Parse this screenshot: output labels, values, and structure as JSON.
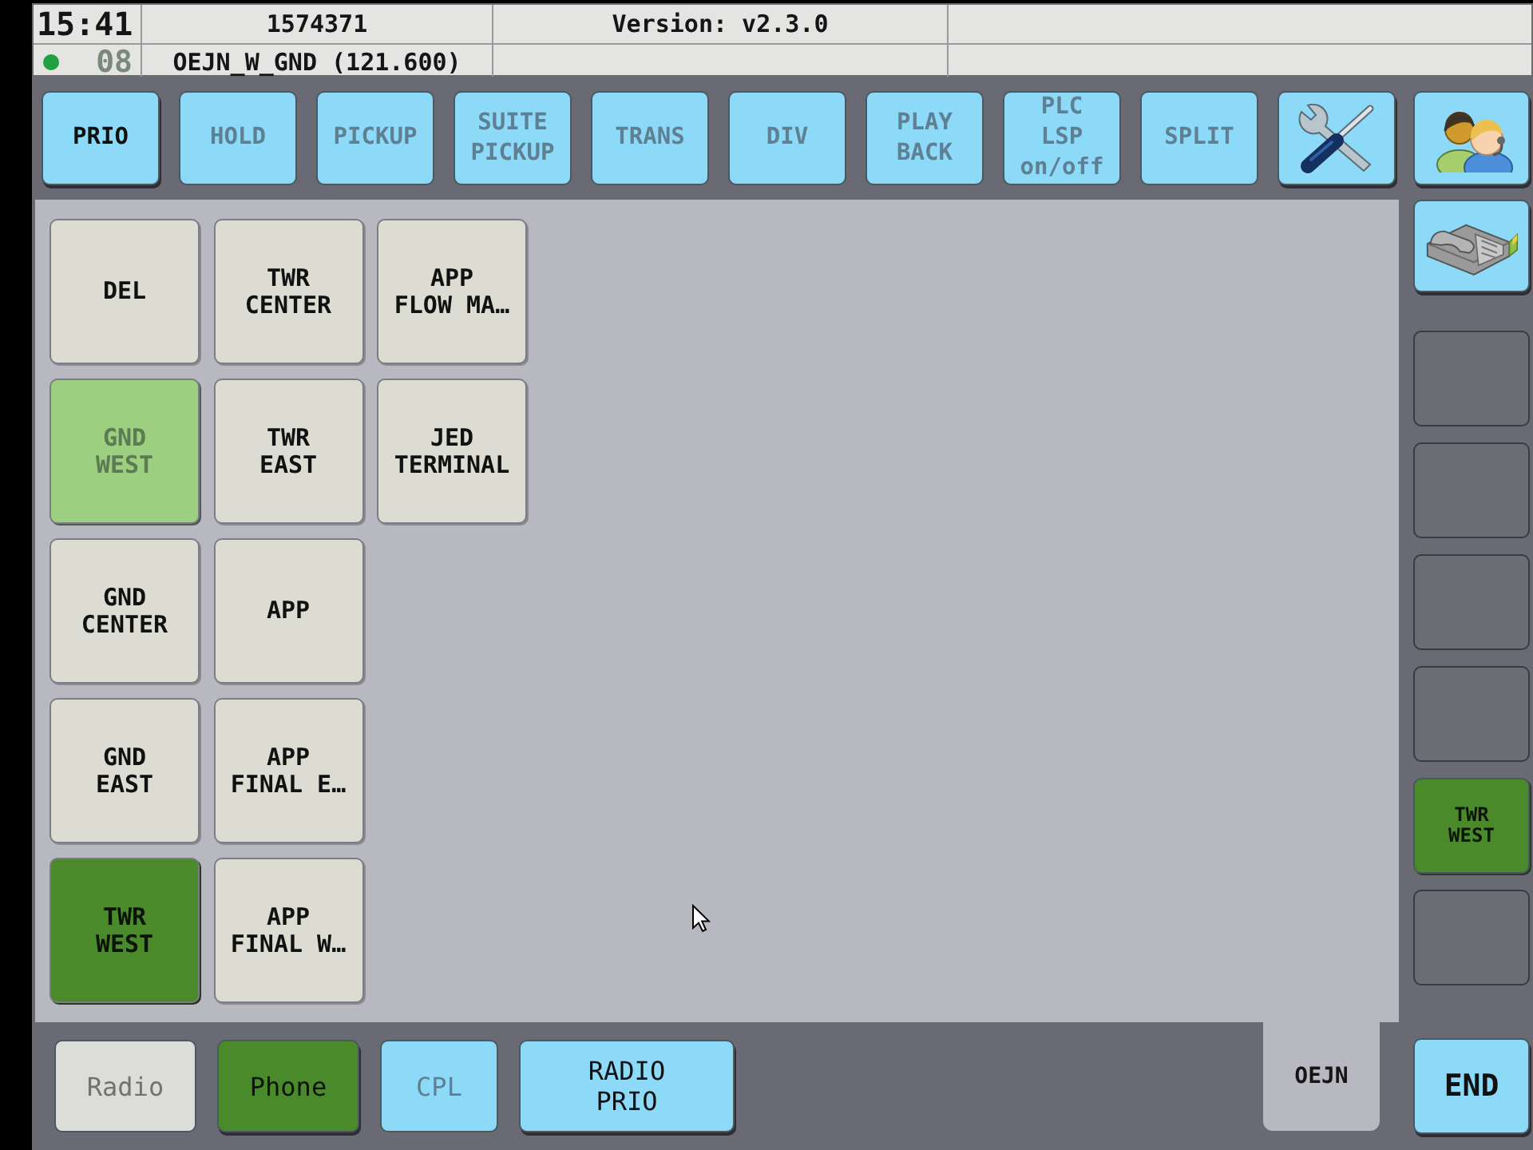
{
  "header": {
    "time": "15:41",
    "session": "1574371",
    "version": "Version: v2.3.0",
    "link_up": true,
    "counter": "08",
    "position": "OEJN_W_GND (121.600)"
  },
  "toolbar": {
    "buttons": [
      {
        "label": "PRIO",
        "disabled": false
      },
      {
        "label": "HOLD",
        "disabled": true
      },
      {
        "label": "PICKUP",
        "disabled": true
      },
      {
        "label": "SUITE\nPICKUP",
        "disabled": true
      },
      {
        "label": "TRANS",
        "disabled": true
      },
      {
        "label": "DIV",
        "disabled": true
      },
      {
        "label": "PLAY\nBACK",
        "disabled": true
      },
      {
        "label": "PLC\nLSP\non/off",
        "disabled": true
      },
      {
        "label": "SPLIT",
        "disabled": true
      }
    ]
  },
  "contacts": [
    {
      "label": "DEL",
      "busy": false,
      "connected": false
    },
    {
      "label": "GND\nWEST",
      "busy": true,
      "connected": false
    },
    {
      "label": "GND\nCENTER",
      "busy": false,
      "connected": false
    },
    {
      "label": "GND\nEAST",
      "busy": false,
      "connected": false
    },
    {
      "label": "TWR\nWEST",
      "busy": false,
      "connected": true
    },
    {
      "label": "TWR\nCENTER",
      "busy": false,
      "connected": false
    },
    {
      "label": "TWR\nEAST",
      "busy": false,
      "connected": false
    },
    {
      "label": "APP",
      "busy": false,
      "connected": false
    },
    {
      "label": "APP\nFINAL E…",
      "busy": false,
      "connected": false
    },
    {
      "label": "APP\nFINAL W…",
      "busy": false,
      "connected": false
    },
    {
      "label": "APP\nFLOW MA…",
      "busy": false,
      "connected": false
    },
    {
      "label": "JED\nTERMINAL",
      "busy": false,
      "connected": false
    }
  ],
  "side_keys": [
    {
      "kind": "empty"
    },
    {
      "kind": "empty"
    },
    {
      "kind": "empty"
    },
    {
      "kind": "empty"
    },
    {
      "kind": "line",
      "label": "TWR\nWEST",
      "connected": true
    },
    {
      "kind": "empty"
    }
  ],
  "mode_tabs": [
    {
      "kind": "mode",
      "label": "Radio",
      "selected": false,
      "disabled": true
    },
    {
      "kind": "mode",
      "label": "Phone",
      "selected": true,
      "disabled": false
    },
    {
      "kind": "action",
      "label": "CPL",
      "selected": false,
      "disabled": true
    },
    {
      "kind": "action",
      "label": "RADIO\nPRIO",
      "selected": false,
      "disabled": false
    }
  ],
  "pages": [
    {
      "label": "OEJN",
      "selected": true
    }
  ],
  "end_button": {
    "label": "END"
  }
}
